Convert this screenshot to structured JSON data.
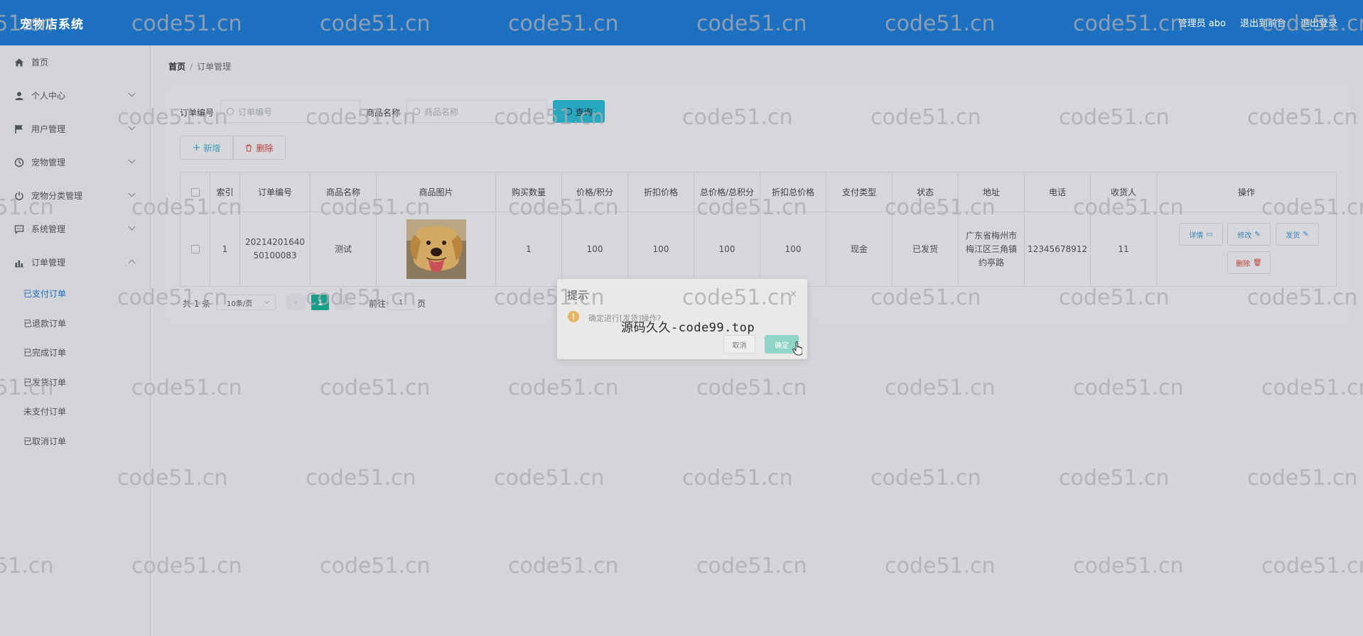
{
  "header": {
    "brand": "宠物店系统",
    "admin": "管理员 abo",
    "back_to_front": "退出到前台",
    "logout": "退出登录"
  },
  "sidebar": {
    "items": [
      {
        "label": "首页",
        "icon": "home-icon"
      },
      {
        "label": "个人中心",
        "icon": "user-icon"
      },
      {
        "label": "用户管理",
        "icon": "flag-icon"
      },
      {
        "label": "宠物管理",
        "icon": "clock-icon"
      },
      {
        "label": "宠物分类管理",
        "icon": "power-icon"
      },
      {
        "label": "系统管理",
        "icon": "chat-icon"
      },
      {
        "label": "订单管理",
        "icon": "chart-icon"
      }
    ],
    "sub_items": [
      "已支付订单",
      "已退款订单",
      "已完成订单",
      "已发货订单",
      "未支付订单",
      "已取消订单"
    ],
    "active_sub": "已支付订单"
  },
  "breadcrumb": {
    "home": "首页",
    "sep": "/",
    "current": "订单管理"
  },
  "search": {
    "order_no_label": "订单编号",
    "order_no_placeholder": "订单编号",
    "goods_name_label": "商品名称",
    "goods_name_placeholder": "商品名称",
    "query_button": "查询"
  },
  "actions": {
    "add": "新增",
    "delete": "删除"
  },
  "table": {
    "headers": [
      "索引",
      "订单编号",
      "商品名称",
      "商品图片",
      "购买数量",
      "价格/积分",
      "折扣价格",
      "总价格/总积分",
      "折扣总价格",
      "支付类型",
      "状态",
      "地址",
      "电话",
      "收货人",
      "操作"
    ],
    "rows": [
      {
        "index": "1",
        "order_no": "2021420164050100083",
        "goods_name": "测试",
        "quantity": "1",
        "price": "100",
        "discount_price": "100",
        "total": "100",
        "discount_total": "100",
        "pay_type": "现金",
        "status": "已发货",
        "address": "广东省梅州市梅江区三角镇约亭路",
        "phone": "12345678912",
        "receiver": "11",
        "ops": {
          "detail": "详情",
          "edit": "修改",
          "ship": "发货",
          "delete": "删除"
        }
      }
    ]
  },
  "pagination": {
    "total": "共 1 条",
    "page_size": "10条/页",
    "current_page": "1",
    "goto_label": "前往",
    "goto_value": "1",
    "page_suffix": "页"
  },
  "dialog": {
    "title": "提示",
    "close": "×",
    "message": "确定进行[发货]操作?",
    "cancel": "取消",
    "confirm": "确定",
    "banner": "源码久久-code99.top"
  },
  "watermark": "code51.cn",
  "colors": {
    "header_bg": "#1d70c0",
    "query_btn": "#28a8bf",
    "page_active": "#16a087",
    "confirm_btn": "#8fd6c8",
    "warn": "#e7b460"
  }
}
